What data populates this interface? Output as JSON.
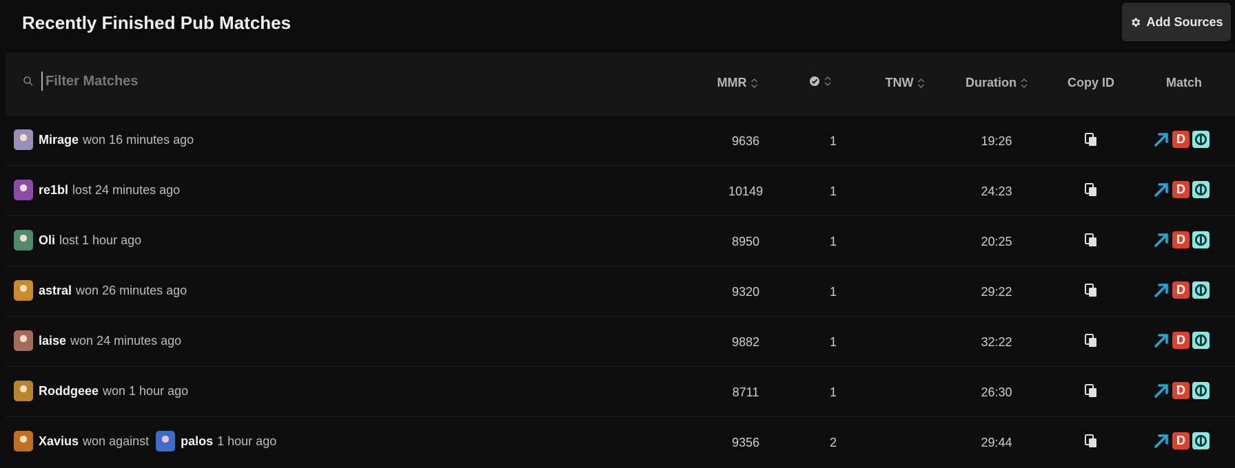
{
  "header": {
    "title": "Recently Finished Pub Matches",
    "add_sources_label": "Add Sources",
    "add_sources_icon": "gear-icon"
  },
  "filter": {
    "placeholder": "Filter Matches",
    "value": "",
    "icon": "search-icon"
  },
  "columns": {
    "mmr": "MMR",
    "verified_icon": "check-circle-icon",
    "tnw": "TNW",
    "duration": "Duration",
    "copy_id": "Copy ID",
    "match": "Match"
  },
  "rows": [
    {
      "player": "Mirage",
      "text": "won 16 minutes ago",
      "mmr": "9636",
      "count": "1",
      "duration": "19:26",
      "avatar_color": "#9a8fb8"
    },
    {
      "player": "re1bl",
      "text": "lost 24 minutes ago",
      "mmr": "10149",
      "count": "1",
      "duration": "24:23",
      "avatar_color": "#8e4aa8"
    },
    {
      "player": "Oli",
      "text": "lost 1 hour ago",
      "mmr": "8950",
      "count": "1",
      "duration": "20:25",
      "avatar_color": "#4f8a6a"
    },
    {
      "player": "astral",
      "text": "won 26 minutes ago",
      "mmr": "9320",
      "count": "1",
      "duration": "29:22",
      "avatar_color": "#c98a2a"
    },
    {
      "player": "laise",
      "text": "won 24 minutes ago",
      "mmr": "9882",
      "count": "1",
      "duration": "32:22",
      "avatar_color": "#a86a5a"
    },
    {
      "player": "Roddgeee",
      "text": "won 1 hour ago",
      "mmr": "8711",
      "count": "1",
      "duration": "26:30",
      "avatar_color": "#b8862a"
    },
    {
      "player": "Xavius",
      "text": "won against",
      "opponent": "palos",
      "time": "1 hour ago",
      "mmr": "9356",
      "count": "2",
      "duration": "29:44",
      "avatar_color": "#c0701e",
      "opponent_color": "#3a6ec8"
    }
  ],
  "match_links": {
    "arrow_icon": "external-link-arrow-icon",
    "d_label": "D",
    "o_icon": "opendota-icon"
  },
  "colors": {
    "accent_arrow": "#1ea8d8",
    "badge_d": "#e0402a",
    "badge_o": "#8de6df"
  }
}
